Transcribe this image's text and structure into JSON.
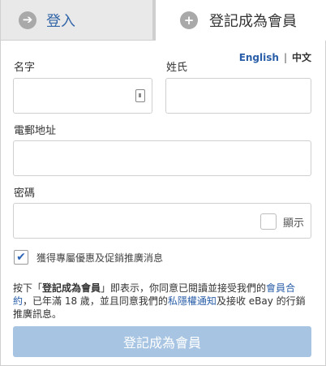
{
  "tabs": {
    "signin_label": "登入",
    "register_label": "登記成為會員",
    "signin_icon": "arrow-right-circle-icon",
    "register_icon": "plus-circle-icon"
  },
  "language": {
    "english": "English",
    "separator": "|",
    "chinese": "中文"
  },
  "form": {
    "first_name_label": "名字",
    "last_name_label": "姓氏",
    "email_label": "電郵地址",
    "password_label": "密碼",
    "first_name_value": "",
    "last_name_value": "",
    "email_value": "",
    "password_value": "",
    "show_password_label": "顯示"
  },
  "promo": {
    "checked": true,
    "label": "獲得專屬優惠及促銷推廣消息"
  },
  "legal": {
    "part1": "按下「",
    "button_ref": "登記成為會員",
    "part2": "」即表示，你同意已閱讀並接受我們的",
    "user_agreement": "會員合約",
    "part3": "，已年滿 18 歲，並且同意我們的",
    "privacy": "私隱權通知",
    "part4": "及接收 eBay 的行銷推廣訊息。"
  },
  "submit": {
    "label": "登記成為會員"
  },
  "colors": {
    "link": "#2a5ea8",
    "submit_bg": "#a7c4e2",
    "check": "#2a63b8"
  }
}
